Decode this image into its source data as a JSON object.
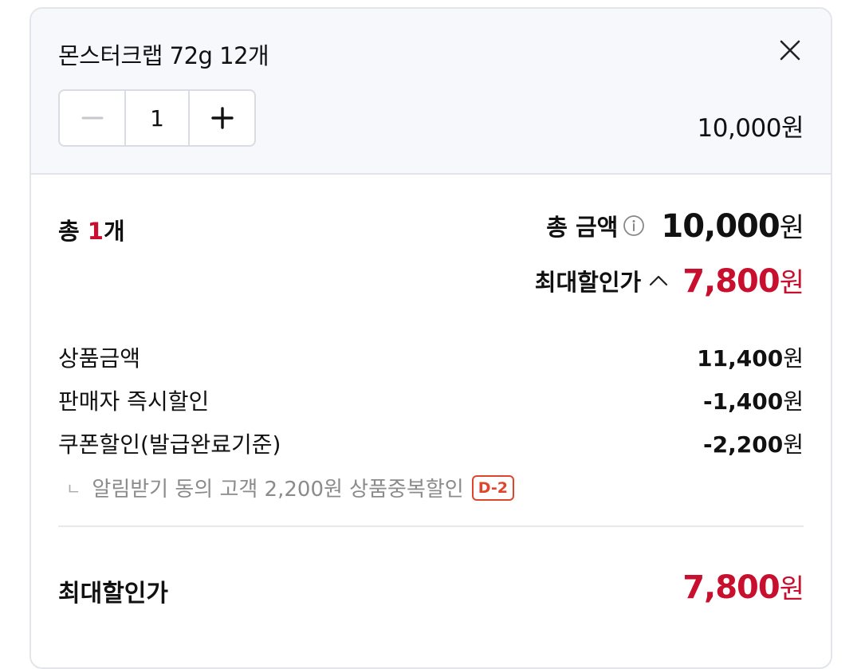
{
  "option": {
    "product_name": "몬스터크랩 72g 12개",
    "quantity": "1",
    "price": "10,000원"
  },
  "summary": {
    "total_label": "총 ",
    "total_count": "1",
    "total_unit": "개",
    "total_amount_label": "총 금액",
    "total_amount_value": "10,000",
    "max_discount_label": "최대할인가",
    "max_discount_value": "7,800",
    "currency": "원"
  },
  "details": [
    {
      "label": "상품금액",
      "value": "11,400"
    },
    {
      "label": "판매자 즉시할인",
      "value": "-1,400"
    },
    {
      "label": "쿠폰할인(발급완료기준)",
      "value": "-2,200"
    }
  ],
  "coupon_note": {
    "mark": "ㄴ",
    "text": "알림받기 동의 고객 2,200원 상품중복할인",
    "badge": "D-2"
  },
  "final": {
    "label": "최대할인가",
    "value": "7,800"
  },
  "colors": {
    "accent_red": "#c8102e",
    "badge_orange": "#e0452b",
    "option_bg": "#f6f8fc",
    "border": "#e3e5ea"
  },
  "icons": [
    "close-icon",
    "minus-icon",
    "plus-icon",
    "info-icon",
    "chevron-up-icon"
  ]
}
